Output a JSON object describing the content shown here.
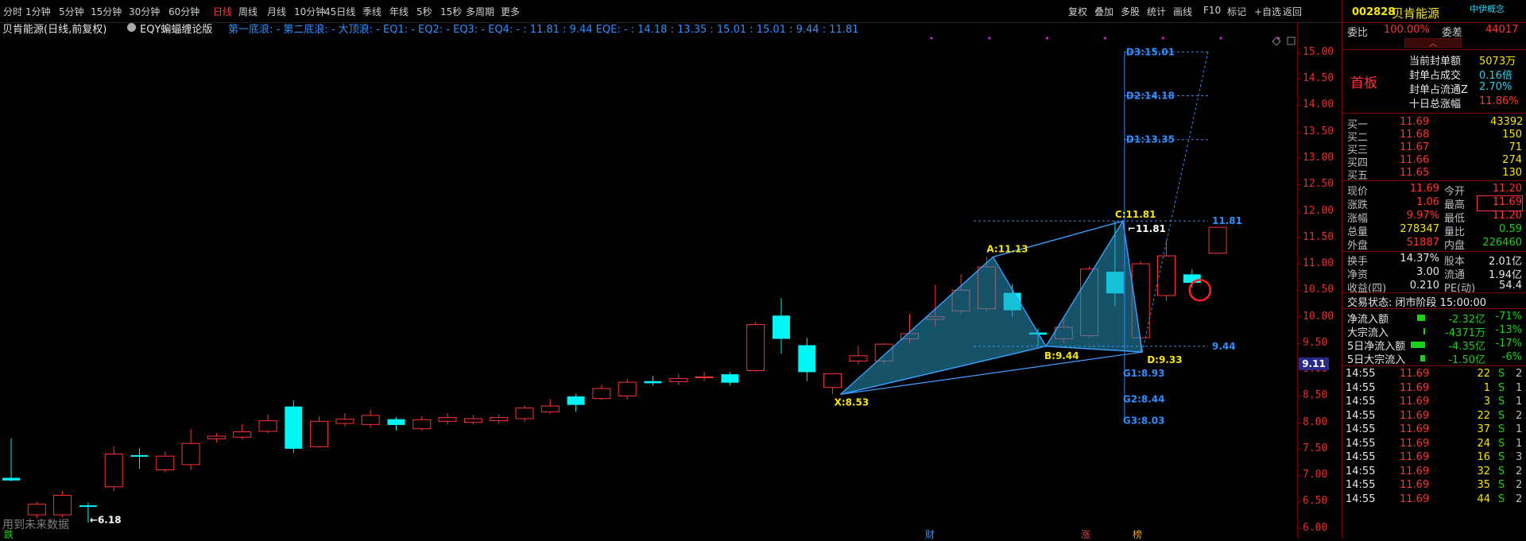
{
  "periods": [
    "分时",
    "1分钟",
    "5分钟",
    "15分钟",
    "30分钟",
    "60分钟",
    "日线",
    "周线",
    "月线",
    "10分钟",
    "45日线",
    "季线",
    "年线",
    "5秒",
    "15秒",
    "多周期",
    "更多"
  ],
  "active_period": "日线",
  "tools": [
    "复权",
    "叠加",
    "多股",
    "统计",
    "画线",
    "F10",
    "标记",
    "+自选",
    "返回"
  ],
  "stock_title": "贝肯能源(日线,前复权)",
  "indicator_name": "EQY蝙蝠缠论版",
  "indicator_values": "第一底浪: - 第二底浪: - 大顶浪: - EQ1: - EQ2: - EQ3: - EQ4: - : 11.81 : 9.44 EQE: - : 14.18 : 13.35 : 15.01 : 15.01 : 9.44 : 11.81",
  "price_axis": [
    "15.00",
    "14.50",
    "14.00",
    "13.50",
    "13.00",
    "12.50",
    "12.00",
    "11.50",
    "11.00",
    "10.50",
    "10.00",
    "9.50",
    "9.00",
    "8.50",
    "8.00",
    "7.50",
    "7.00",
    "6.50",
    "6.00"
  ],
  "current_price_tag": "9.11",
  "annotations": {
    "X": "X:8.53",
    "A": "A:11.13",
    "B": "B:9.44",
    "C": "C:11.81",
    "D": "D:9.33",
    "D1": "D1:13.35",
    "D2": "D2:14.18",
    "D3": "D3:15.01",
    "G1": "G1:8.93",
    "G2": "G2:8.44",
    "G3": "G3:8.03",
    "hi": "11.81",
    "lo": "9.44",
    "c_right": "11.81",
    "min": "6.18"
  },
  "bottom_note": "用到未来数据",
  "foot_marks": [
    {
      "text": "跌",
      "color": "#19d219"
    },
    {
      "text": "财",
      "color": "#2f8fff"
    },
    {
      "text": "涨",
      "color": "#ff3333"
    },
    {
      "text": "榜",
      "color": "#f5a000"
    }
  ],
  "panel": {
    "code": "002828",
    "name": "贝肯能源",
    "concept": "中伊概念",
    "weibi_label": "委比",
    "weibi": "100.00%",
    "weicha_label": "委差",
    "weicha": "44017",
    "status_badge": "首板",
    "seal": [
      {
        "label": "当前封单额",
        "value": "5073万"
      },
      {
        "label": "封单占成交",
        "value": "0.16倍"
      },
      {
        "label": "封单占流通Z",
        "value": "2.70%"
      },
      {
        "label": "十日总涨幅",
        "value": "11.86%"
      }
    ],
    "bids": [
      {
        "label": "买一",
        "price": "11.69",
        "vol": "43392"
      },
      {
        "label": "买二",
        "price": "11.68",
        "vol": "150"
      },
      {
        "label": "买三",
        "price": "11.67",
        "vol": "71"
      },
      {
        "label": "买四",
        "price": "11.66",
        "vol": "274"
      },
      {
        "label": "买五",
        "price": "11.65",
        "vol": "130"
      }
    ],
    "quote": [
      {
        "l1": "现价",
        "v1": "11.69",
        "l2": "今开",
        "v2": "11.20"
      },
      {
        "l1": "涨跌",
        "v1": "1.06",
        "l2": "最高",
        "v2": "11.69"
      },
      {
        "l1": "涨幅",
        "v1": "9.97%",
        "l2": "最低",
        "v2": "11.20"
      },
      {
        "l1": "总量",
        "v1": "278347",
        "l2": "量比",
        "v2": "0.59"
      },
      {
        "l1": "外盘",
        "v1": "51887",
        "l2": "内盘",
        "v2": "226460"
      }
    ],
    "stats": [
      {
        "l1": "换手",
        "v1": "14.37%",
        "l2": "股本",
        "v2": "2.01亿"
      },
      {
        "l1": "净资",
        "v1": "3.00",
        "l2": "流通",
        "v2": "1.94亿"
      },
      {
        "l1": "收益(四)",
        "v1": "0.210",
        "l2": "PE(动)",
        "v2": "54.4"
      }
    ],
    "trade_status": "交易状态: 闭市阶段 15:00:00",
    "flows": [
      {
        "label": "净流入额",
        "value": "-2.32亿",
        "pct": "-71%"
      },
      {
        "label": "大宗流入",
        "value": "-4371万",
        "pct": "-13%"
      },
      {
        "label": "5日净流入额",
        "value": "-4.35亿",
        "pct": "-17%"
      },
      {
        "label": "5日大宗流入",
        "value": "-1.50亿",
        "pct": "-6%"
      }
    ],
    "ticks": [
      {
        "t": "14:55",
        "p": "11.69",
        "v": "22",
        "s": "S",
        "n": "2"
      },
      {
        "t": "14:55",
        "p": "11.69",
        "v": "1",
        "s": "S",
        "n": "1"
      },
      {
        "t": "14:55",
        "p": "11.69",
        "v": "3",
        "s": "S",
        "n": "1"
      },
      {
        "t": "14:55",
        "p": "11.69",
        "v": "22",
        "s": "S",
        "n": "2"
      },
      {
        "t": "14:55",
        "p": "11.69",
        "v": "37",
        "s": "S",
        "n": "1"
      },
      {
        "t": "14:55",
        "p": "11.69",
        "v": "24",
        "s": "S",
        "n": "1"
      },
      {
        "t": "14:55",
        "p": "11.69",
        "v": "16",
        "s": "S",
        "n": "3"
      },
      {
        "t": "14:55",
        "p": "11.69",
        "v": "32",
        "s": "S",
        "n": "2"
      },
      {
        "t": "14:55",
        "p": "11.69",
        "v": "35",
        "s": "S",
        "n": "2"
      },
      {
        "t": "14:55",
        "p": "11.69",
        "v": "44",
        "s": "S",
        "n": "2"
      }
    ]
  },
  "chart_data": {
    "type": "candlestick",
    "ylim": [
      5.8,
      15.3
    ],
    "candles": [
      [
        6.9,
        6.95,
        7.7,
        6.88,
        "down"
      ],
      [
        6.25,
        6.45,
        6.5,
        6.18,
        "up"
      ],
      [
        6.25,
        6.62,
        6.7,
        6.2,
        "up"
      ],
      [
        6.43,
        6.43,
        6.48,
        6.1,
        "down"
      ],
      [
        6.78,
        7.4,
        7.55,
        6.7,
        "up"
      ],
      [
        7.38,
        7.38,
        7.52,
        7.12,
        "down"
      ],
      [
        7.36,
        7.1,
        7.45,
        7.05,
        "up"
      ],
      [
        7.2,
        7.6,
        7.88,
        7.1,
        "up"
      ],
      [
        7.69,
        7.74,
        7.8,
        7.62,
        "up"
      ],
      [
        7.72,
        7.82,
        7.97,
        7.68,
        "up"
      ],
      [
        7.83,
        8.03,
        8.15,
        7.8,
        "up"
      ],
      [
        7.5,
        8.3,
        8.42,
        7.42,
        "down"
      ],
      [
        7.54,
        8.02,
        8.12,
        7.52,
        "up"
      ],
      [
        7.98,
        8.06,
        8.18,
        7.92,
        "up"
      ],
      [
        7.96,
        8.13,
        8.24,
        7.9,
        "up"
      ],
      [
        7.95,
        8.06,
        8.1,
        7.85,
        "down"
      ],
      [
        7.88,
        8.05,
        8.12,
        7.84,
        "up"
      ],
      [
        8.02,
        8.09,
        8.18,
        7.96,
        "up"
      ],
      [
        8.0,
        8.07,
        8.14,
        7.96,
        "up"
      ],
      [
        8.03,
        8.09,
        8.15,
        7.98,
        "up"
      ],
      [
        8.07,
        8.27,
        8.32,
        8.01,
        "up"
      ],
      [
        8.2,
        8.31,
        8.44,
        8.16,
        "up"
      ],
      [
        8.49,
        8.33,
        8.54,
        8.2,
        "down"
      ],
      [
        8.45,
        8.64,
        8.72,
        8.42,
        "up"
      ],
      [
        8.5,
        8.76,
        8.82,
        8.43,
        "up"
      ],
      [
        8.78,
        8.74,
        8.88,
        8.7,
        "down"
      ],
      [
        8.77,
        8.83,
        8.92,
        8.71,
        "up"
      ],
      [
        8.85,
        8.86,
        8.95,
        8.78,
        "up"
      ],
      [
        8.91,
        8.75,
        8.95,
        8.7,
        "down"
      ],
      [
        8.98,
        9.85,
        9.9,
        8.95,
        "up"
      ],
      [
        10.02,
        9.58,
        10.35,
        9.3,
        "down"
      ],
      [
        9.46,
        8.95,
        9.6,
        8.78,
        "down"
      ],
      [
        8.92,
        8.66,
        8.9,
        8.53,
        "up"
      ],
      [
        9.16,
        9.26,
        9.45,
        9.1,
        "up"
      ],
      [
        9.16,
        9.48,
        9.5,
        9.1,
        "up"
      ],
      [
        9.68,
        9.58,
        10.05,
        9.5,
        "up"
      ],
      [
        9.95,
        10.0,
        10.6,
        9.82,
        "up"
      ],
      [
        10.11,
        10.5,
        10.8,
        10.05,
        "up"
      ],
      [
        10.15,
        10.94,
        11.13,
        10.1,
        "up"
      ],
      [
        10.45,
        10.12,
        10.62,
        10.0,
        "down"
      ],
      [
        9.7,
        9.66,
        9.78,
        9.44,
        "down"
      ],
      [
        9.58,
        9.8,
        9.95,
        9.5,
        "up"
      ],
      [
        9.64,
        10.9,
        10.95,
        9.6,
        "up"
      ],
      [
        10.85,
        10.44,
        11.81,
        10.2,
        "down"
      ],
      [
        9.6,
        11.0,
        11.05,
        9.33,
        "up"
      ],
      [
        10.4,
        11.15,
        11.45,
        10.3,
        "up"
      ],
      [
        10.8,
        10.64,
        10.9,
        10.55,
        "down"
      ],
      [
        11.2,
        11.69,
        11.69,
        11.2,
        "up"
      ]
    ],
    "xabcd": {
      "X": 8.53,
      "A": 11.13,
      "B": 9.44,
      "C": 11.81,
      "D": 9.33
    },
    "targets": {
      "D1": 13.35,
      "D2": 14.18,
      "D3": 15.01,
      "G1": 8.93,
      "G2": 8.44,
      "G3": 8.03,
      "hi": 11.81,
      "lo": 9.44
    }
  }
}
